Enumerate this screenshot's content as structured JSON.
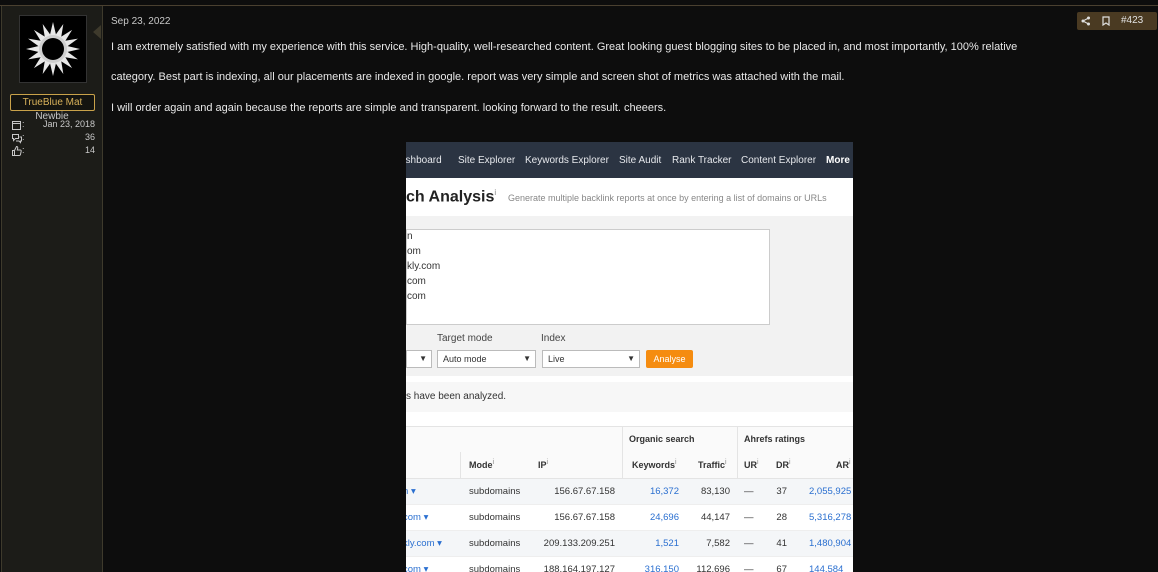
{
  "author": {
    "username": "TrueBlue Mat",
    "rank": "Newbie",
    "stats": [
      {
        "icon": "calendar-icon",
        "label": ":",
        "value": "Jan 23, 2018"
      },
      {
        "icon": "messages-icon",
        "label": ":",
        "value": "36"
      },
      {
        "icon": "thumbs-up-icon",
        "label": ":",
        "value": "14"
      }
    ]
  },
  "post": {
    "date": "Sep 23, 2022",
    "number": "#423",
    "paragraphs": [
      "I am extremely satisfied with my experience with this service. High-quality, well-researched content. Great looking guest blogging sites to be placed in, and most importantly, 100% relative",
      "category. Best part is indexing, all our placements are indexed in google. report was very simple and screen shot of metrics was attached with the mail.",
      "I will order again and again because the reports are simple and transparent. looking forward to the result. cheeers."
    ]
  },
  "screenshot": {
    "nav": [
      "ashboard",
      "Site Explorer",
      "Keywords Explorer",
      "Site Audit",
      "Rank Tracker",
      "Content Explorer",
      "More"
    ],
    "title": "ch Analysis",
    "title_info": "i",
    "subtitle": "Generate multiple backlink reports at once by entering a list of domains or URLs",
    "textarea_lines": [
      "n",
      "om",
      "kly.com",
      "com",
      "com"
    ],
    "labels": {
      "target_mode": "Target mode",
      "index": "Index"
    },
    "selects": {
      "first": "",
      "target_mode": "Auto mode",
      "index": "Live"
    },
    "analyse_button": "Analyse",
    "notice": "s have been analyzed.",
    "table": {
      "group_headers": {
        "organic": "Organic search",
        "ahrefs": "Ahrefs ratings"
      },
      "columns": {
        "mode": "Mode",
        "ip": "IP",
        "keywords": "Keywords",
        "traffic": "Traffic",
        "ur": "UR",
        "dr": "DR",
        "ar": "AR"
      },
      "rows": [
        {
          "domain": "n",
          "mode": "subdomains",
          "ip": "156.67.67.158",
          "keywords": "16,372",
          "traffic": "83,130",
          "ur": "—",
          "dr": "37",
          "ar": "2,055,925"
        },
        {
          "domain": "com",
          "mode": "subdomains",
          "ip": "156.67.67.158",
          "keywords": "24,696",
          "traffic": "44,147",
          "ur": "—",
          "dr": "28",
          "ar": "5,316,278"
        },
        {
          "domain": "kly.com",
          "mode": "subdomains",
          "ip": "209.133.209.251",
          "keywords": "1,521",
          "traffic": "7,582",
          "ur": "—",
          "dr": "41",
          "ar": "1,480,904"
        },
        {
          "domain": "com",
          "mode": "subdomains",
          "ip": "188.164.197.127",
          "keywords": "316,150",
          "traffic": "112,696",
          "ur": "—",
          "dr": "67",
          "ar": "144,584"
        }
      ]
    }
  }
}
